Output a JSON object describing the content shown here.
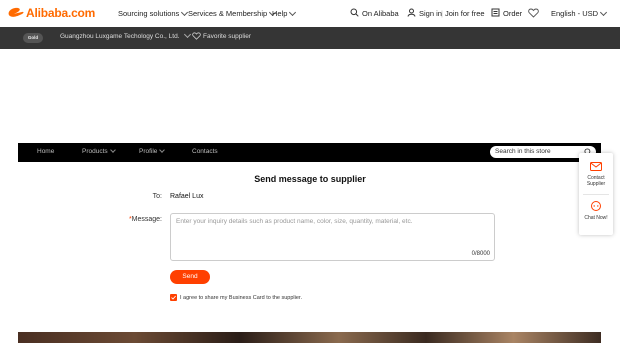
{
  "header": {
    "logo_text": "Alibaba.com",
    "nav": [
      "Sourcing solutions",
      "Services & Membership",
      "Help"
    ],
    "on_alibaba": "On Alibaba",
    "sign_in": "Sign in",
    "join": "Join for free",
    "order": "Order",
    "locale": "English - USD"
  },
  "storebar": {
    "badge": "Gold",
    "company": "Guangzhou Luxgame Techology Co., Ltd.",
    "favorite": "Favorite supplier"
  },
  "storenav": {
    "items": [
      "Home",
      "Products",
      "Profile",
      "Contacts"
    ],
    "search_placeholder": "Search in this store"
  },
  "form": {
    "title": "Send message to supplier",
    "to_label": "To:",
    "to_value": "Rafael Lux",
    "required_mark": "*",
    "message_label": "Message:",
    "message_placeholder": "Enter your inquiry details such as product name, color, size, quantity, material, etc.",
    "counter": "0/8000",
    "send_label": "Send",
    "agree_label": "I agree to share my Business Card to the supplier."
  },
  "side": {
    "contact_label_1": "Contact",
    "contact_label_2": "Supplier",
    "chat_label": "Chat Now!"
  },
  "colors": {
    "brand": "#ff6a00",
    "accent": "#ff4000",
    "storebar": "#353535",
    "storenav": "#000000"
  }
}
